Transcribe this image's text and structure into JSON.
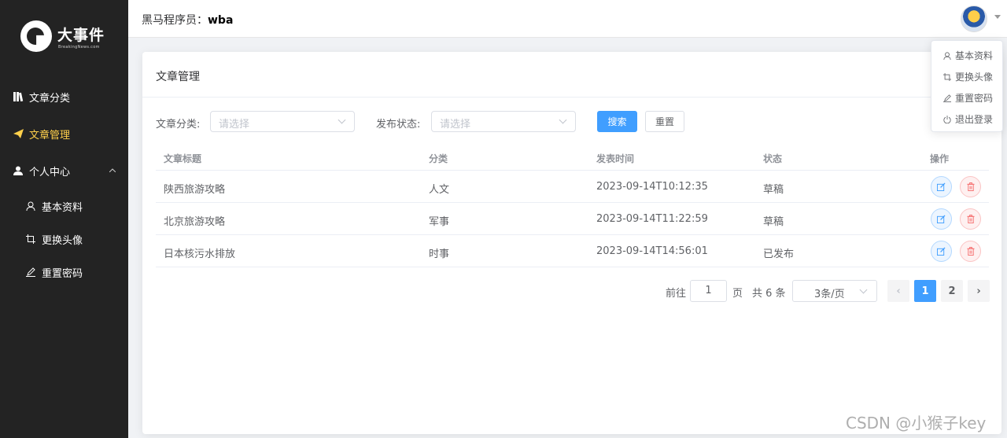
{
  "sidebar": {
    "logo_text": "大事件",
    "logo_sub": "BreakingNews.com",
    "items": [
      {
        "label": "文章分类",
        "icon": "book-icon"
      },
      {
        "label": "文章管理",
        "icon": "send-icon"
      },
      {
        "label": "个人中心",
        "icon": "user-icon"
      }
    ],
    "subitems": [
      {
        "label": "基本资料",
        "icon": "user-outline-icon"
      },
      {
        "label": "更换头像",
        "icon": "crop-icon"
      },
      {
        "label": "重置密码",
        "icon": "edit-pen-icon"
      }
    ]
  },
  "header": {
    "prefix": "黑马程序员：",
    "username": "wba"
  },
  "dropdown": {
    "items": [
      {
        "label": "基本资料",
        "icon": "user-outline-icon"
      },
      {
        "label": "更换头像",
        "icon": "crop-icon"
      },
      {
        "label": "重置密码",
        "icon": "edit-pen-icon"
      },
      {
        "label": "退出登录",
        "icon": "power-icon"
      }
    ]
  },
  "main": {
    "title": "文章管理",
    "filter": {
      "category_label": "文章分类:",
      "category_placeholder": "请选择",
      "status_label": "发布状态:",
      "status_placeholder": "请选择",
      "search_label": "搜索",
      "reset_label": "重置"
    },
    "table": {
      "columns": [
        "文章标题",
        "分类",
        "发表时间",
        "状态",
        "操作"
      ],
      "rows": [
        {
          "title": "陕西旅游攻略",
          "category": "人文",
          "time": "2023-09-14T10:12:35",
          "status": "草稿"
        },
        {
          "title": "北京旅游攻略",
          "category": "军事",
          "time": "2023-09-14T11:22:59",
          "status": "草稿"
        },
        {
          "title": "日本核污水排放",
          "category": "时事",
          "time": "2023-09-14T14:56:01",
          "status": "已发布"
        }
      ]
    },
    "pagination": {
      "goto_label": "前往",
      "goto_value": "1",
      "page_label": "页",
      "total": "共 6 条",
      "page_size": "3条/页",
      "prev": "‹",
      "next": "›",
      "pages": [
        "1",
        "2"
      ],
      "current": "1"
    }
  },
  "watermark": "CSDN @小猴子key",
  "colors": {
    "sidebar_bg": "#232323",
    "active_menu": "#ffd04b",
    "primary": "#409eff",
    "danger": "#f56c6c"
  }
}
